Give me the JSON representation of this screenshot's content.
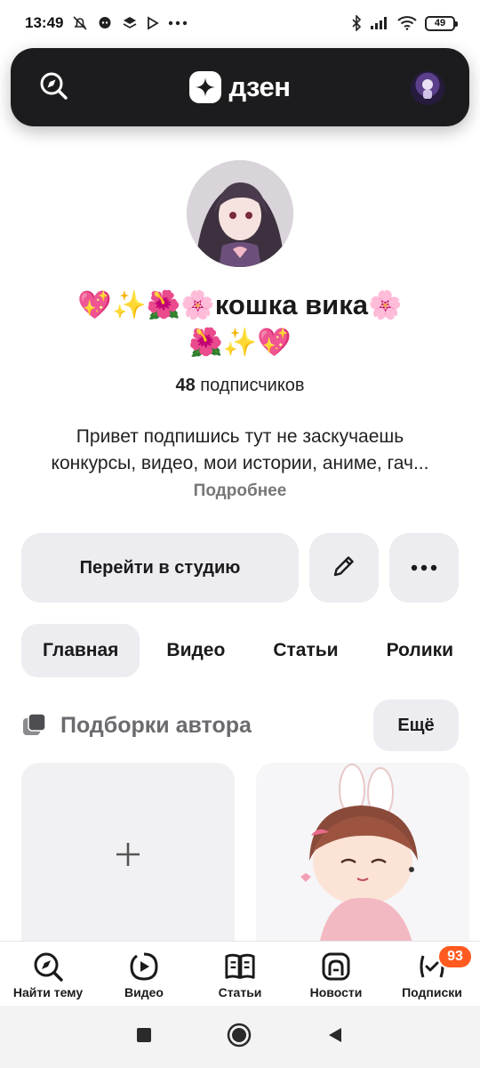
{
  "status_bar": {
    "time": "13:49",
    "battery": "49"
  },
  "header": {
    "brand": "дзен",
    "search_icon": "search-compass-icon",
    "avatar_icon": "user-avatar"
  },
  "profile": {
    "name_emoji_before": "💖✨🌺🌸",
    "name": "кошка вика",
    "name_emoji_after_line1": "🌸",
    "name_emoji_line2": "🌺✨💖",
    "subscribers_count": "48",
    "subscribers_label": "подписчиков",
    "bio_line1": "Привет подпишись тут не заскучаешь",
    "bio_line2": "конкурсы, видео, мои истории, аниме, гач...",
    "more": "Подробнее"
  },
  "actions": {
    "studio": "Перейти в студию",
    "edit_icon": "pencil-icon",
    "more_icon": "dots-icon"
  },
  "tabs": [
    {
      "label": "Главная",
      "active": true
    },
    {
      "label": "Видео",
      "active": false
    },
    {
      "label": "Статьи",
      "active": false
    },
    {
      "label": "Ролики",
      "active": false
    }
  ],
  "collections": {
    "title": "Подборки автора",
    "all_button": "Ещё"
  },
  "bottom_nav": [
    {
      "label": "Найти тему",
      "icon": "compass-search-icon"
    },
    {
      "label": "Видео",
      "icon": "play-icon"
    },
    {
      "label": "Статьи",
      "icon": "book-icon"
    },
    {
      "label": "Новости",
      "icon": "news-icon"
    },
    {
      "label": "Подписки",
      "icon": "subscriptions-icon",
      "badge": "93"
    }
  ],
  "colors": {
    "header_bg": "#1c1c1e",
    "chip_bg": "#ececf1",
    "badge": "#ff5a1f"
  }
}
